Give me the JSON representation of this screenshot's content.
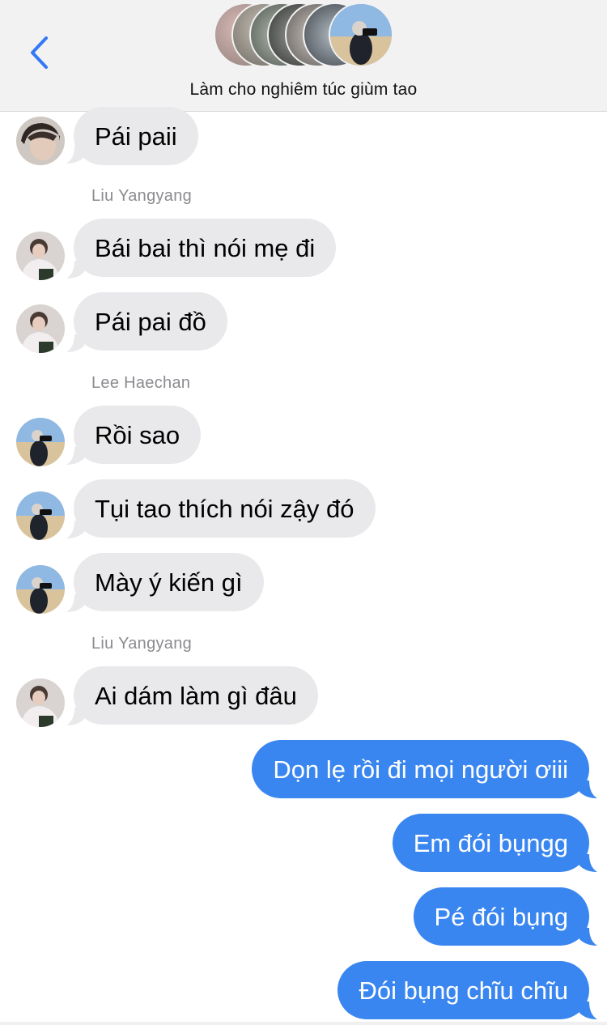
{
  "header": {
    "title": "Làm cho nghiêm túc giùm tao",
    "back_icon": "chevron-left-icon",
    "accent": "#3478f6"
  },
  "participants": [
    "avatar-1",
    "avatar-2",
    "avatar-3",
    "avatar-4",
    "avatar-5",
    "avatar-6",
    "avatar-7"
  ],
  "messages": [
    {
      "type": "incoming",
      "text": "Pái paii",
      "avatar": "avatar-boy-face"
    },
    {
      "type": "sender",
      "text": "Liu Yangyang"
    },
    {
      "type": "incoming",
      "text": "Bái bai thì nói mẹ đi",
      "avatar": "avatar-liu"
    },
    {
      "type": "incoming",
      "text": "Pái pai đồ",
      "avatar": "avatar-liu"
    },
    {
      "type": "sender",
      "text": "Lee Haechan"
    },
    {
      "type": "incoming",
      "text": "Rồi sao",
      "avatar": "avatar-haechan"
    },
    {
      "type": "incoming",
      "text": "Tụi tao thích nói zậy đó",
      "avatar": "avatar-haechan"
    },
    {
      "type": "incoming",
      "text": "Mày ý kiến gì",
      "avatar": "avatar-haechan"
    },
    {
      "type": "sender",
      "text": "Liu Yangyang"
    },
    {
      "type": "incoming",
      "text": "Ai dám làm gì đâu",
      "avatar": "avatar-liu"
    },
    {
      "type": "outgoing",
      "text": "Dọn lẹ rồi đi mọi người ơiii"
    },
    {
      "type": "outgoing",
      "text": "Em đói bụngg"
    },
    {
      "type": "outgoing",
      "text": "Pé đói bụng"
    },
    {
      "type": "outgoing",
      "text": "Đói bụng chĩu chĩu"
    }
  ],
  "colors": {
    "incoming_bubble": "#e9e9eb",
    "outgoing_bubble": "#3a86f0",
    "sender_name": "#8b8b90"
  }
}
